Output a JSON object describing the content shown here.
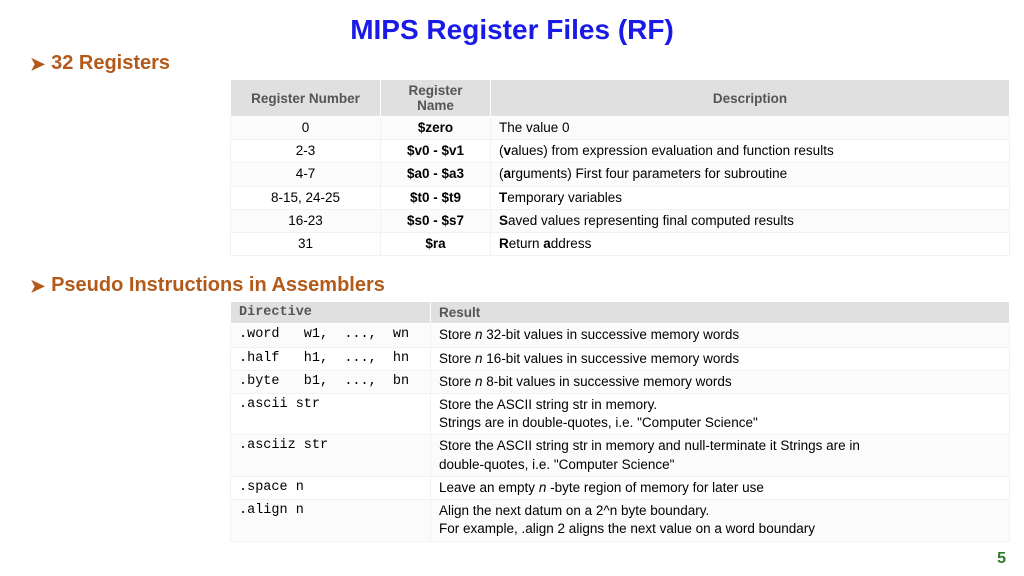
{
  "title": "MIPS Register Files (RF)",
  "page_number": "5",
  "section1": {
    "heading": "32 Registers",
    "headers": {
      "c1": "Register Number",
      "c2": "Register Name",
      "c3": "Description"
    },
    "rows": [
      {
        "num": "0",
        "name": "$zero",
        "b": "",
        "rest": "The value 0"
      },
      {
        "num": "2-3",
        "name": "$v0 - $v1",
        "b": "v",
        "pre": "(",
        "rest": "alues) from expression evaluation and function results"
      },
      {
        "num": "4-7",
        "name": "$a0 - $a3",
        "b": "a",
        "pre": "(",
        "rest": "rguments) First four parameters for subroutine"
      },
      {
        "num": "8-15, 24-25",
        "name": "$t0 - $t9",
        "b": "T",
        "rest": "emporary variables"
      },
      {
        "num": "16-23",
        "name": "$s0 - $s7",
        "b": "S",
        "rest": "aved values representing final computed results"
      },
      {
        "num": "31",
        "name": "$ra",
        "b": "R",
        "rest": "eturn ",
        "b2": "a",
        "rest2": "ddress"
      }
    ]
  },
  "section2": {
    "heading": "Pseudo Instructions in Assemblers",
    "headers": {
      "c1": "Directive",
      "c2": "Result"
    },
    "rows": [
      {
        "dir": ".word   w1,  ...,  wn",
        "pref": "Store ",
        "it": "n ",
        "suf": "32-bit values in successive memory words"
      },
      {
        "dir": ".half   h1,  ...,  hn",
        "pref": "Store ",
        "it": "n ",
        "suf": "16-bit values in successive memory words"
      },
      {
        "dir": ".byte   b1,  ...,  bn",
        "pref": "Store ",
        "it": "n ",
        "suf": "8-bit values in successive memory words"
      },
      {
        "dir": ".ascii str",
        "line1": "Store the ASCII string str in memory.",
        "line2": "Strings are in double-quotes, i.e. \"Computer Science\""
      },
      {
        "dir": ".asciiz str",
        "line1": "Store the ASCII string str in memory and null-terminate it Strings are in",
        "line2": "double-quotes, i.e. \"Computer Science\""
      },
      {
        "dir": ".space n",
        "pref": "Leave an empty ",
        "it": "n",
        "suf": " -byte region of memory for later use"
      },
      {
        "dir": ".align n",
        "line1": "Align the next datum on a 2^n byte boundary.",
        "line2": "For example, .align 2 aligns the next value on a word boundary"
      }
    ]
  }
}
